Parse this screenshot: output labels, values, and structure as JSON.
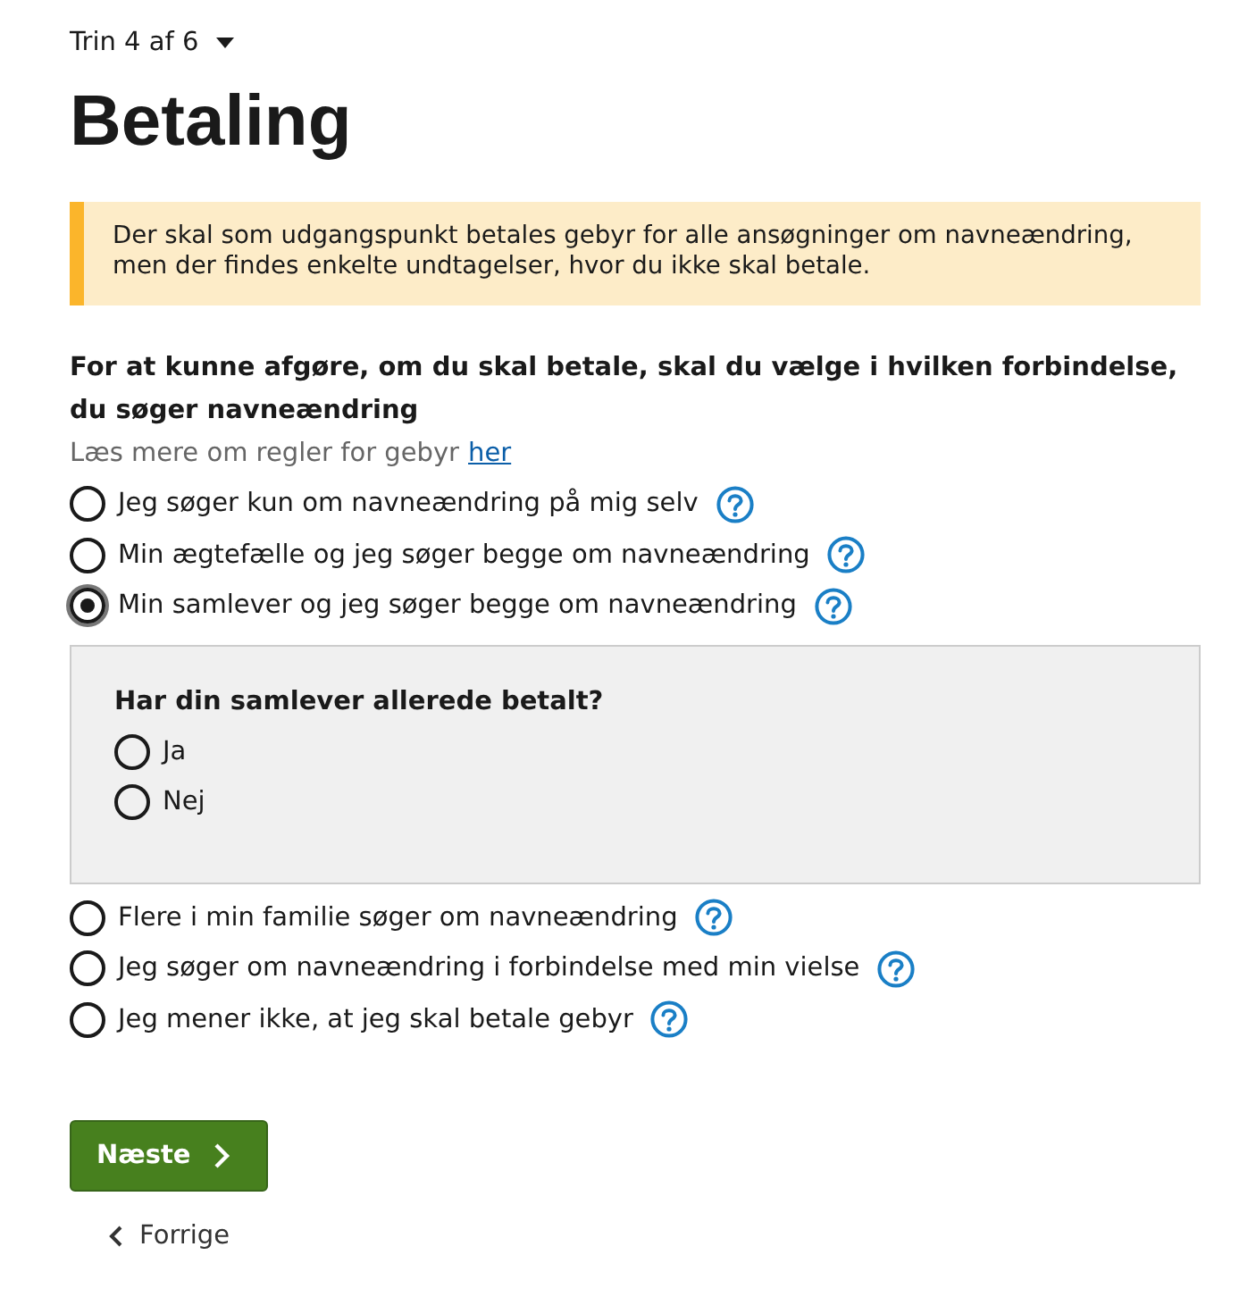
{
  "step": {
    "label": "Trin 4 af 6"
  },
  "title": "Betaling",
  "notice": "Der skal som udgangspunkt betales gebyr for alle ansøgninger om navneændring, men der findes enkelte undtagelser, hvor du ikke skal betale.",
  "question": {
    "label": "For at kunne afgøre, om du skal betale, skal du vælge i hvilken forbindelse, du søger navneændring",
    "hint": "Læs mere om regler for gebyr",
    "link": "her"
  },
  "options": [
    {
      "label": "Jeg søger kun om navneændring på mig selv",
      "selected": false
    },
    {
      "label": "Min ægtefælle og jeg søger begge om navneændring",
      "selected": false
    },
    {
      "label": "Min samlever og jeg søger begge om navneændring",
      "selected": true,
      "followup": {
        "question": "Har din samlever allerede betalt?",
        "options": [
          {
            "label": "Ja",
            "selected": false
          },
          {
            "label": "Nej",
            "selected": false
          }
        ]
      }
    },
    {
      "label": "Flere i min familie søger om navneændring",
      "selected": false
    },
    {
      "label": "Jeg søger om navneændring i forbindelse med min vielse",
      "selected": false
    },
    {
      "label": "Jeg mener ikke, at jeg skal betale gebyr",
      "selected": false
    }
  ],
  "next_button": "Næste",
  "back_link": "Forrige"
}
